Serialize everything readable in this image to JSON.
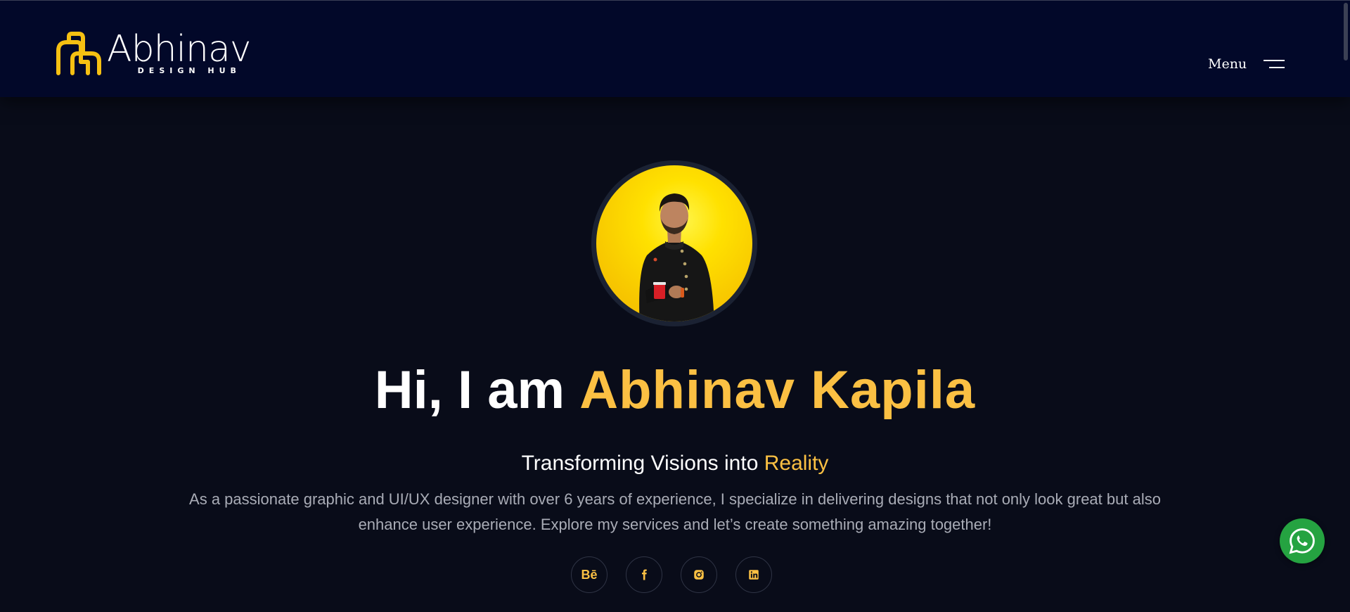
{
  "header": {
    "logo_name": "Abhinav",
    "logo_sub": "DESIGN HUB",
    "menu_label": "Menu"
  },
  "hero": {
    "greeting": "Hi, I am ",
    "name": "Abhinav Kapila",
    "tagline_prefix": "Transforming Visions into ",
    "tagline_accent": "Reality",
    "description": "As a passionate graphic and UI/UX designer with over 6 years of experience, I specialize in delivering designs that not only look great but also enhance user experience. Explore my services and let’s create something amazing together!"
  },
  "socials": [
    {
      "icon": "behance-icon",
      "label": "Bē"
    },
    {
      "icon": "facebook-icon"
    },
    {
      "icon": "instagram-icon"
    },
    {
      "icon": "linkedin-icon"
    }
  ],
  "colors": {
    "header_bg": "#020829",
    "page_bg": "#090c19",
    "accent": "#fbc043",
    "whatsapp": "#25a341"
  }
}
